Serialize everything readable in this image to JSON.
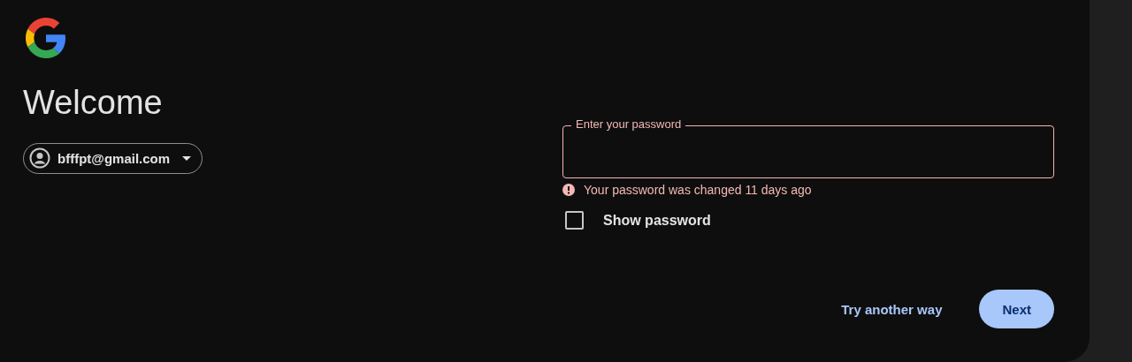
{
  "heading": "Welcome",
  "account": {
    "email": "bfffpt@gmail.com"
  },
  "password_field": {
    "label": "Enter your password",
    "invalid": true
  },
  "error_message": "Your password was changed 11 days ago",
  "show_password": {
    "label": "Show password",
    "checked": false
  },
  "buttons": [
    {
      "label": "Try another way",
      "kind": "text"
    },
    {
      "label": "Next",
      "kind": "filled"
    }
  ]
}
